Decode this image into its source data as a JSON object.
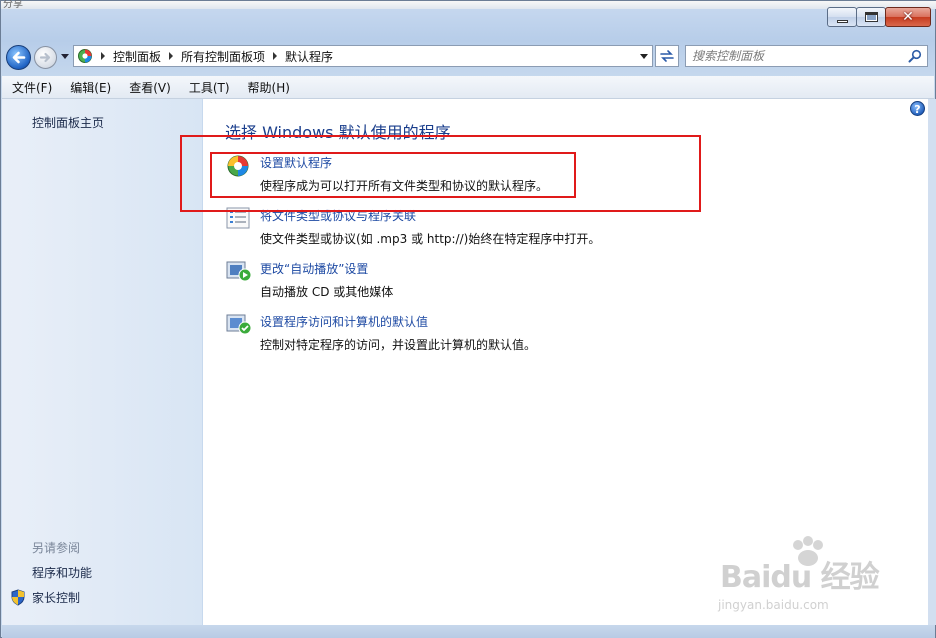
{
  "background": {
    "top_left_text": "分享"
  },
  "window": {
    "close_glyph": "✕"
  },
  "address": {
    "crumbs": [
      "控制面板",
      "所有控制面板项",
      "默认程序"
    ]
  },
  "search": {
    "placeholder": "搜索控制面板"
  },
  "menu": [
    "文件(F)",
    "编辑(E)",
    "查看(V)",
    "工具(T)",
    "帮助(H)"
  ],
  "sidebar": {
    "home_link": "控制面板主页",
    "see_also_heading": "另请参阅",
    "see_also": [
      "程序和功能",
      "家长控制"
    ]
  },
  "main": {
    "help_glyph": "?",
    "title": "选择 Windows 默认使用的程序",
    "tasks": [
      {
        "link": "设置默认程序",
        "desc": "使程序成为可以打开所有文件类型和协议的默认程序。",
        "icon": "default-programs-icon"
      },
      {
        "link": "将文件类型或协议与程序关联",
        "desc": "使文件类型或协议(如 .mp3 或 http://)始终在特定程序中打开。",
        "icon": "file-association-icon"
      },
      {
        "link": "更改“自动播放”设置",
        "desc": "自动播放 CD 或其他媒体",
        "icon": "autoplay-icon"
      },
      {
        "link": "设置程序访问和计算机的默认值",
        "desc": "控制对特定程序的访问，并设置此计算机的默认值。",
        "icon": "program-access-icon"
      }
    ]
  },
  "watermark": {
    "brand": "Baidu 经验",
    "url": "jingyan.baidu.com"
  },
  "colors": {
    "highlight": "#e01a1a",
    "link": "#1e4aa3",
    "title": "#1a3e8c"
  }
}
